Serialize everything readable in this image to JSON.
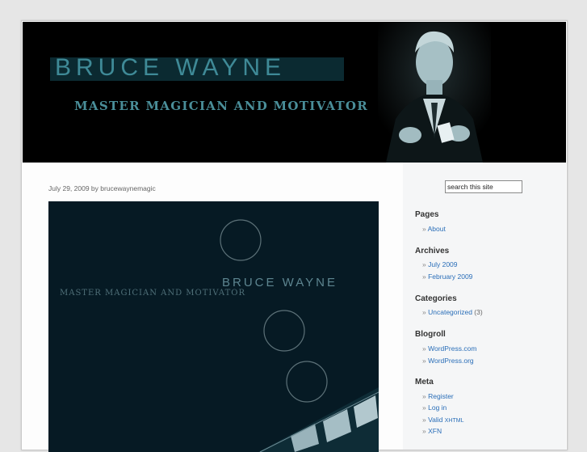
{
  "site": {
    "title": "BRUCE WAYNE",
    "subtitle": "MASTER MAGICIAN AND MOTIVATOR"
  },
  "post": {
    "meta": "July 29, 2009 by brucewaynemagic",
    "image": {
      "title": "BRUCE WAYNE",
      "subtitle": "MASTER MAGICIAN AND MOTIVATOR"
    }
  },
  "sidebar": {
    "search_value": "search this site",
    "bullet": "»",
    "pages": {
      "heading": "Pages",
      "items": [
        "About"
      ]
    },
    "archives": {
      "heading": "Archives",
      "items": [
        "July 2009",
        "February 2009"
      ]
    },
    "categories": {
      "heading": "Categories",
      "items": [
        {
          "label": "Uncategorized",
          "count": "(3)"
        }
      ]
    },
    "blogroll": {
      "heading": "Blogroll",
      "items": [
        "WordPress.com",
        "WordPress.org"
      ]
    },
    "meta": {
      "heading": "Meta",
      "items": [
        "Register",
        "Log in",
        "Valid",
        "XFN"
      ],
      "xhtml": "XHTML"
    }
  },
  "colors": {
    "accent_link": "#2a6eb8",
    "header_bg": "#000000",
    "title_teal": "#3f8a97",
    "post_image_bg": "#061a24"
  }
}
